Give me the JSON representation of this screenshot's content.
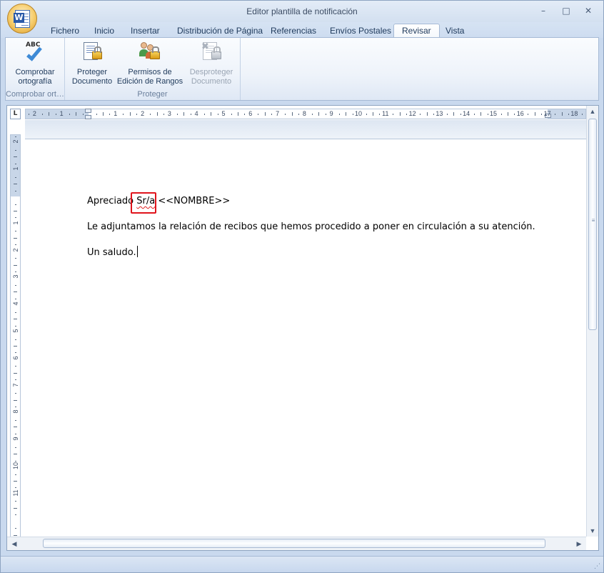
{
  "window": {
    "title": "Editor plantilla de notificación",
    "minimize": "–",
    "maximize": "□",
    "close": "✕",
    "app_icon": "word-document-icon",
    "app_icon_letter": "W"
  },
  "tabs": [
    {
      "label": "Fichero"
    },
    {
      "label": "Inicio"
    },
    {
      "label": "Insertar"
    },
    {
      "label": "Distribución de Página"
    },
    {
      "label": "Referencias"
    },
    {
      "label": "Envíos Postales"
    },
    {
      "label": "Revisar",
      "active": true
    },
    {
      "label": "Vista"
    }
  ],
  "ribbon": {
    "groups": [
      {
        "label": "Comprobar ort…",
        "buttons": [
          {
            "line1": "Comprobar",
            "line2": "ortografía",
            "icon": "spellcheck-icon",
            "icon_text": "ABC",
            "enabled": true
          }
        ]
      },
      {
        "label": "Proteger",
        "buttons": [
          {
            "line1": "Proteger",
            "line2": "Documento",
            "icon": "protect-document-icon",
            "enabled": true
          },
          {
            "line1": "Permisos de",
            "line2": "Edición de Rangos",
            "icon": "range-permissions-icon",
            "enabled": true
          },
          {
            "line1": "Desproteger",
            "line2": "Documento",
            "icon": "unprotect-document-icon",
            "enabled": false
          }
        ]
      }
    ]
  },
  "ruler": {
    "corner": "L",
    "h_numbers": [
      "2",
      "1",
      "1",
      "2",
      "3",
      "4",
      "5",
      "6",
      "7",
      "8",
      "9",
      "10",
      "11",
      "12",
      "13",
      "14",
      "15",
      "16",
      "17",
      "18"
    ],
    "v_numbers": [
      "2",
      "1",
      "1",
      "2",
      "3",
      "4",
      "5",
      "6",
      "7",
      "8",
      "9",
      "10",
      "11"
    ]
  },
  "document": {
    "line1_prefix": "Apreciado ",
    "line1_misspelled": "Sr/a",
    "line1_suffix": " <<NOMBRE>>",
    "line2": "Le adjuntamos la relación de recibos que hemos procedido a poner en circulación a su atención.",
    "line3": "Un saludo."
  },
  "colors": {
    "highlight_box": "#e0141c",
    "spellcheck_underline": "#e02020",
    "accent": "#1e395b"
  }
}
